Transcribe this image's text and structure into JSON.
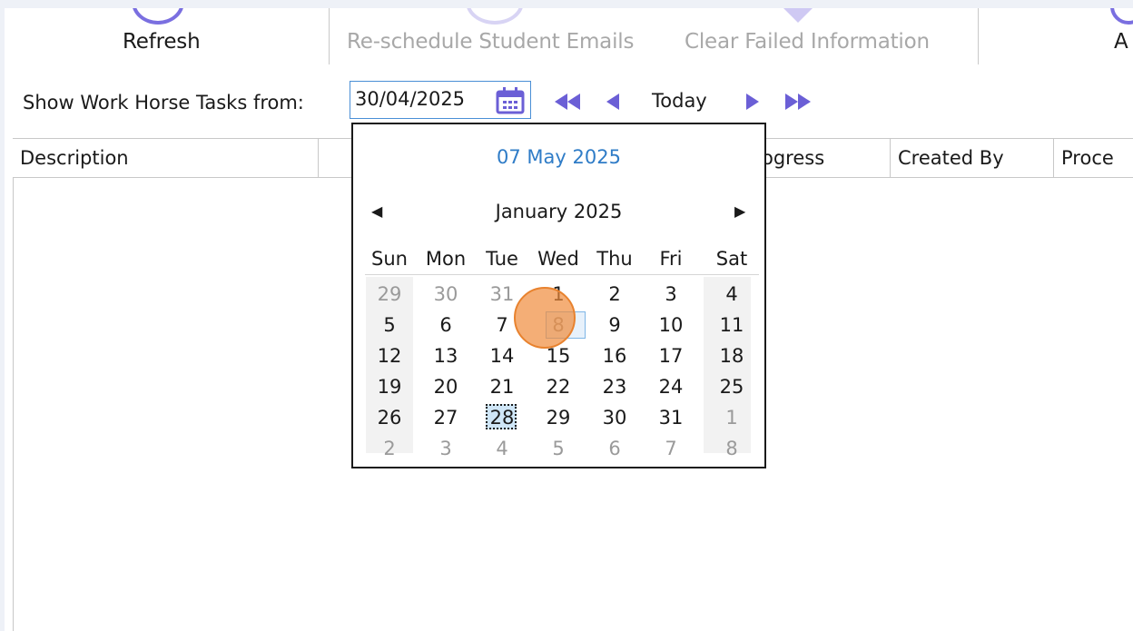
{
  "toolbar": {
    "refresh_label": "Refresh",
    "reschedule_label": "Re-schedule Student Emails",
    "clear_failed_label": "Clear Failed Information",
    "partial_label": "A"
  },
  "filter": {
    "label": "Show Work Horse Tasks from:",
    "date_value": "30/04/2025",
    "today_label": "Today"
  },
  "grid": {
    "columns": [
      "Description",
      "",
      "ogress",
      "Created By",
      "Proce"
    ]
  },
  "calendar": {
    "today_link": "07 May 2025",
    "month_title": "January 2025",
    "weekdays": [
      "Sun",
      "Mon",
      "Tue",
      "Wed",
      "Thu",
      "Fri",
      "Sat"
    ],
    "weeks": [
      [
        "29",
        "30",
        "31",
        "1",
        "2",
        "3",
        "4"
      ],
      [
        "5",
        "6",
        "7",
        "8",
        "9",
        "10",
        "11"
      ],
      [
        "12",
        "13",
        "14",
        "15",
        "16",
        "17",
        "18"
      ],
      [
        "19",
        "20",
        "21",
        "22",
        "23",
        "24",
        "25"
      ],
      [
        "26",
        "27",
        "28",
        "29",
        "30",
        "31",
        "1"
      ],
      [
        "2",
        "3",
        "4",
        "5",
        "6",
        "7",
        "8"
      ]
    ],
    "selected_day": "28",
    "hovered_day": "8"
  },
  "colors": {
    "accent_purple": "#6b5fd6",
    "link_blue": "#2f7cc7",
    "click_indicator": "#f08c3c"
  }
}
